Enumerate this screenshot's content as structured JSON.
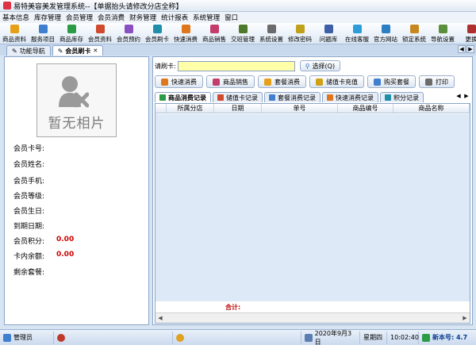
{
  "window": {
    "title": "易特美容美发管理系统--【单据抬头请修改分店全称】"
  },
  "menu": [
    "基本信息",
    "库存管理",
    "会员管理",
    "会员消费",
    "财务管理",
    "统计报表",
    "系统管理",
    "窗口"
  ],
  "toolbar": [
    {
      "label": "商品资料",
      "icon": "box-icon",
      "color": "#e6a017"
    },
    {
      "label": "服务项目",
      "icon": "service-icon",
      "color": "#3f7fd0"
    },
    {
      "label": "商品库存",
      "icon": "stock-icon",
      "color": "#2b9b46"
    },
    {
      "label": "会员资料",
      "icon": "member-icon",
      "color": "#d04a2f"
    },
    {
      "label": "会员预约",
      "icon": "calendar-icon",
      "color": "#8a50c2"
    },
    {
      "label": "会员刷卡",
      "icon": "card-icon",
      "color": "#1f8ea8"
    },
    {
      "label": "快速消费",
      "icon": "bolt-icon",
      "color": "#e0761b"
    },
    {
      "label": "商品销售",
      "icon": "cart-icon",
      "color": "#c43c6a"
    },
    {
      "label": "交班管理",
      "icon": "shift-icon",
      "color": "#4c7a2a"
    },
    {
      "label": "系统设置",
      "icon": "gear-icon",
      "color": "#6b6b6b"
    },
    {
      "label": "修改密码",
      "icon": "key-icon",
      "color": "#c2a11a"
    },
    {
      "label": "问题库",
      "icon": "question-icon",
      "color": "#3d5fa8"
    },
    {
      "label": "在线客服",
      "icon": "chat-icon",
      "color": "#2c9dd8"
    },
    {
      "label": "官方网站",
      "icon": "globe-icon",
      "color": "#2d7fc4"
    },
    {
      "label": "锁定系统",
      "icon": "lock-icon",
      "color": "#c7871e"
    },
    {
      "label": "导航设置",
      "icon": "nav-icon",
      "color": "#5a8f3b"
    },
    {
      "label": "更换",
      "icon": "swap-icon",
      "color": "#b03030"
    }
  ],
  "navtabs": [
    {
      "label": "功能导航",
      "active": false
    },
    {
      "label": "会员刷卡",
      "active": true
    }
  ],
  "left": {
    "no_photo": "暂无相片",
    "fields": [
      {
        "label": "会员卡号:",
        "value": ""
      },
      {
        "label": "会员姓名:",
        "value": ""
      },
      {
        "label": "会员手机:",
        "value": ""
      },
      {
        "label": "会员等级:",
        "value": ""
      },
      {
        "label": "会员生日:",
        "value": ""
      },
      {
        "label": "到期日期:",
        "value": ""
      },
      {
        "label": "会员积分:",
        "value": "0.00"
      },
      {
        "label": "卡内余额:",
        "value": "0.00"
      },
      {
        "label": "剩余套餐:",
        "value": ""
      }
    ]
  },
  "search": {
    "label": "请刷卡:",
    "value": "",
    "choose_label": "选择(Q)"
  },
  "actions": [
    {
      "label": "快速消费",
      "color": "#e0761b"
    },
    {
      "label": "商品销售",
      "color": "#c43c6a"
    },
    {
      "label": "套餐消费",
      "color": "#e6a017"
    },
    {
      "label": "储值卡充值",
      "color": "#d0a015"
    },
    {
      "label": "购买套餐",
      "color": "#3f7fd0"
    },
    {
      "label": "打印",
      "color": "#6b6b6b"
    }
  ],
  "subtabs": [
    {
      "label": "商品消费记录",
      "active": true,
      "color": "#2b9b46"
    },
    {
      "label": "储值卡记录",
      "active": false,
      "color": "#d04a2f"
    },
    {
      "label": "套餐消费记录",
      "active": false,
      "color": "#3f7fd0"
    },
    {
      "label": "快速消费记录",
      "active": false,
      "color": "#e0761b"
    },
    {
      "label": "积分记录",
      "active": false,
      "color": "#1f8ea8"
    }
  ],
  "grid": {
    "columns": [
      "所属分店",
      "日期",
      "单号",
      "商品编号",
      "商品名称"
    ],
    "total_label": "合计:"
  },
  "status": {
    "user": "管理员",
    "date": "2020年9月3日",
    "weekday": "星期四",
    "time": "10:02:40",
    "version": "新本号: 4.7"
  }
}
